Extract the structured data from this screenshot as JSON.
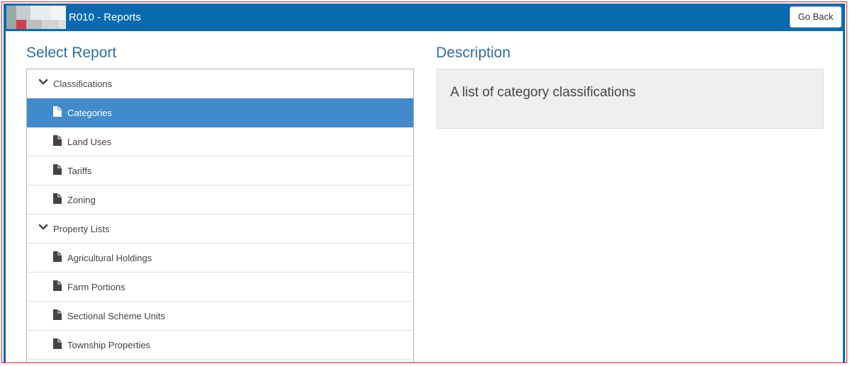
{
  "header": {
    "title": "R010 - Reports",
    "go_back_label": "Go Back"
  },
  "select_report": {
    "heading": "Select Report",
    "items": [
      {
        "type": "group",
        "label": "Classifications"
      },
      {
        "type": "leaf",
        "label": "Categories",
        "selected": true
      },
      {
        "type": "leaf",
        "label": "Land Uses"
      },
      {
        "type": "leaf",
        "label": "Tariffs"
      },
      {
        "type": "leaf",
        "label": "Zoning"
      },
      {
        "type": "group",
        "label": "Property Lists"
      },
      {
        "type": "leaf",
        "label": "Agricultural Holdings"
      },
      {
        "type": "leaf",
        "label": "Farm Portions"
      },
      {
        "type": "leaf",
        "label": "Sectional Scheme Units"
      },
      {
        "type": "leaf",
        "label": "Township Properties"
      }
    ]
  },
  "description": {
    "heading": "Description",
    "text": "A list of category classifications"
  },
  "colors": {
    "header_bar": "#0a6ab0",
    "selected_row": "#428bca",
    "heading_text": "#2f6f9f",
    "frame_border": "#e2242b"
  },
  "icons": {
    "group": "chevron-down-icon",
    "leaf": "document-icon"
  }
}
